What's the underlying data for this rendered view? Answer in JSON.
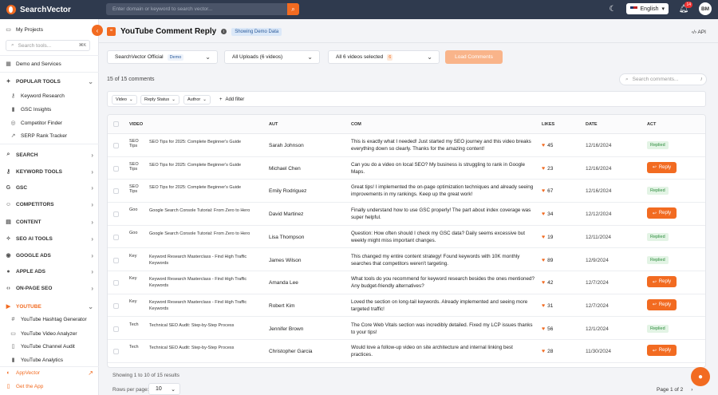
{
  "topbar": {
    "brand": "SearchVector",
    "search_placeholder": "Enter domain or keyword to search vector...",
    "language": "English",
    "notification_count": "14",
    "user_initials": "BM"
  },
  "sidebar": {
    "my_projects": "My Projects",
    "search_placeholder": "Search tools...",
    "search_shortcut": "⌘K",
    "demo_services": "Demo and Services",
    "popular_tools": "POPULAR TOOLS",
    "popular_items": [
      "Keyword Research",
      "GSC Insights",
      "Competitor Finder",
      "SERP Rank Tracker"
    ],
    "sections": [
      "SEARCH",
      "KEYWORD TOOLS",
      "GSC",
      "COMPETITORS",
      "CONTENT",
      "SEO AI TOOLS",
      "GOOGLE ADS",
      "APPLE ADS",
      "ON-PAGE SEO"
    ],
    "youtube_section": "YOUTUBE",
    "youtube_items": [
      "YouTube Hashtag Generator",
      "YouTube Video Analyzer",
      "YouTube Channel Audit",
      "YouTube Analytics"
    ],
    "appvector": "AppVector",
    "get_app": "Get the App"
  },
  "header": {
    "title": "YouTube Comment Reply",
    "badge": "Showing Demo Data",
    "api": "API"
  },
  "controls": {
    "channel": "SearchVector Official",
    "channel_tag": "Demo",
    "uploads": "All Uploads (6 videos)",
    "videos_selected": "All 6 videos selected",
    "videos_count": "6",
    "load_button": "Load Comments",
    "count_text": "15 of 15 comments",
    "search_placeholder": "Search comments...",
    "search_shortcut": "/"
  },
  "filters": {
    "chips": [
      "Video",
      "Reply Status",
      "Author"
    ],
    "add_filter": "Add filter"
  },
  "table": {
    "columns": [
      "VIDEO",
      "AUT",
      "COM",
      "LIKES",
      "DATE",
      "ACT"
    ],
    "rows": [
      {
        "thumb": "SEO Tips",
        "video": "SEO Tips for 2025: Complete Beginner's Guide",
        "author": "Sarah Johnson",
        "comment": "This is exactly what I needed! Just started my SEO journey and this video breaks everything down so clearly. Thanks for the amazing content!",
        "likes": "45",
        "date": "12/16/2024",
        "status": "Replied"
      },
      {
        "thumb": "SEO Tips",
        "video": "SEO Tips for 2025: Complete Beginner's Guide",
        "author": "Michael Chen",
        "comment": "Can you do a video on local SEO? My business is struggling to rank in Google Maps.",
        "likes": "23",
        "date": "12/16/2024",
        "status": "Reply"
      },
      {
        "thumb": "SEO Tips",
        "video": "SEO Tips for 2025: Complete Beginner's Guide",
        "author": "Emily Rodriguez",
        "comment": "Great tips! I implemented the on-page optimization techniques and already seeing improvements in my rankings. Keep up the great work!",
        "likes": "67",
        "date": "12/16/2024",
        "status": "Replied"
      },
      {
        "thumb": "Goo",
        "video": "Google Search Console Tutorial: From Zero to Hero",
        "author": "David Martinez",
        "comment": "Finally understand how to use GSC properly! The part about index coverage was super helpful.",
        "likes": "34",
        "date": "12/12/2024",
        "status": "Reply"
      },
      {
        "thumb": "Goo",
        "video": "Google Search Console Tutorial: From Zero to Hero",
        "author": "Lisa Thompson",
        "comment": "Question: How often should I check my GSC data? Daily seems excessive but weekly might miss important changes.",
        "likes": "19",
        "date": "12/11/2024",
        "status": "Replied"
      },
      {
        "thumb": "Key",
        "video": "Keyword Research Masterclass - Find High Traffic Keywords",
        "author": "James Wilson",
        "comment": "This changed my entire content strategy! Found keywords with 10K monthly searches that competitors weren't targeting.",
        "likes": "89",
        "date": "12/9/2024",
        "status": "Replied"
      },
      {
        "thumb": "Key",
        "video": "Keyword Research Masterclass - Find High Traffic Keywords",
        "author": "Amanda Lee",
        "comment": "What tools do you recommend for keyword research besides the ones mentioned? Any budget-friendly alternatives?",
        "likes": "42",
        "date": "12/7/2024",
        "status": "Reply"
      },
      {
        "thumb": "Key",
        "video": "Keyword Research Masterclass - Find High Traffic Keywords",
        "author": "Robert Kim",
        "comment": "Loved the section on long-tail keywords. Already implemented and seeing more targeted traffic!",
        "likes": "31",
        "date": "12/7/2024",
        "status": "Reply"
      },
      {
        "thumb": "Tech",
        "video": "Technical SEO Audit: Step-by-Step Process",
        "author": "Jennifer Brown",
        "comment": "The Core Web Vitals section was incredibly detailed. Fixed my LCP issues thanks to your tips!",
        "likes": "56",
        "date": "12/1/2024",
        "status": "Replied"
      },
      {
        "thumb": "Tech",
        "video": "Technical SEO Audit: Step-by-Step Process",
        "author": "Christopher Garcia",
        "comment": "Would love a follow-up video on site architecture and internal linking best practices.",
        "likes": "28",
        "date": "11/30/2024",
        "status": "Reply"
      }
    ]
  },
  "footer": {
    "showing": "Showing 1 to 10 of 15 results",
    "rows_per_page_label": "Rows per page:",
    "rows_per_page": "10",
    "page_info": "Page 1 of 2"
  },
  "colors": {
    "accent": "#f26b21",
    "topbar": "#2f3a4e",
    "replied_bg": "#e3f4e5",
    "replied_text": "#2c8c3c"
  }
}
